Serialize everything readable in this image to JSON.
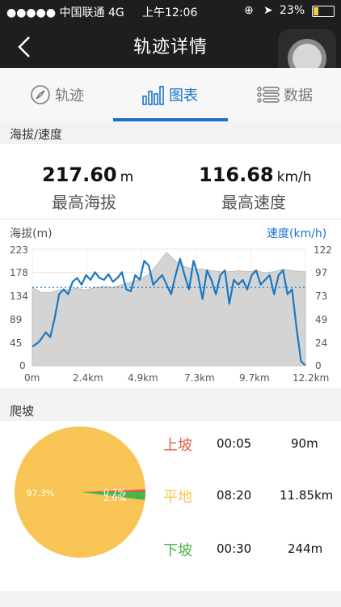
{
  "status_bar": {
    "signal": "●●●●● 中国联通  4G",
    "time": "上午12:06",
    "battery": "23%"
  },
  "nav": {
    "title": "轨迹详情"
  },
  "tabs": [
    {
      "label": "轨迹",
      "icon": "compass-icon"
    },
    {
      "label": "图表",
      "icon": "bar-chart-icon"
    },
    {
      "label": "数据",
      "icon": "list-icon"
    }
  ],
  "summary": {
    "section_title": "海拔/速度",
    "max_altitude": {
      "value": "217.60",
      "unit": "m",
      "label": "最高海拔"
    },
    "max_speed": {
      "value": "116.68",
      "unit": "km/h",
      "label": "最高速度"
    }
  },
  "colors": {
    "accent": "#1a73c7",
    "speed_line": "#1a78c2",
    "altitude_fill": "#d4d4d4",
    "uphill": "#e35d4e",
    "flat": "#f8c456",
    "downhill": "#48b54a"
  },
  "chart_data": [
    {
      "type": "line",
      "left_axis_title": "海拔(m)",
      "right_axis_title": "速度(km/h)",
      "x_ticks": [
        "0m",
        "2.4km",
        "4.9km",
        "7.3km",
        "9.7km",
        "12.2km"
      ],
      "y_left_ticks": [
        "223",
        "178",
        "134",
        "89",
        "45",
        "0"
      ],
      "y_right_ticks": [
        "122",
        "97",
        "73",
        "49",
        "24",
        "0"
      ],
      "x_range_km": [
        0,
        12.2
      ],
      "y_left_range": [
        0,
        223
      ],
      "y_right_range": [
        0,
        122
      ],
      "grid": true,
      "average_speed_reference": 82,
      "series": [
        {
          "name": "海拔",
          "kind": "area",
          "axis": "left",
          "x": [
            0,
            0.4,
            0.8,
            1.2,
            1.6,
            2.0,
            2.4,
            2.8,
            3.2,
            3.6,
            4.0,
            4.4,
            4.8,
            5.2,
            5.6,
            6.0,
            6.4,
            6.8,
            7.2,
            7.6,
            8.0,
            8.4,
            8.8,
            9.2,
            9.6,
            10.0,
            10.4,
            10.8,
            11.2,
            11.6,
            12.2
          ],
          "y": [
            150,
            140,
            140,
            145,
            146,
            148,
            145,
            150,
            152,
            150,
            155,
            160,
            165,
            175,
            195,
            217,
            200,
            190,
            185,
            185,
            182,
            180,
            180,
            182,
            180,
            182,
            178,
            180,
            185,
            182,
            180
          ]
        },
        {
          "name": "速度",
          "kind": "line",
          "axis": "right",
          "x": [
            0,
            0.3,
            0.6,
            0.8,
            1.0,
            1.2,
            1.4,
            1.6,
            1.8,
            2.0,
            2.2,
            2.4,
            2.6,
            2.8,
            3.0,
            3.2,
            3.4,
            3.6,
            3.8,
            4.0,
            4.2,
            4.4,
            4.6,
            4.8,
            5.0,
            5.2,
            5.4,
            5.6,
            5.8,
            6.0,
            6.2,
            6.4,
            6.6,
            6.8,
            7.0,
            7.2,
            7.4,
            7.6,
            7.8,
            8.0,
            8.2,
            8.4,
            8.6,
            8.8,
            9.0,
            9.2,
            9.4,
            9.6,
            9.8,
            10.0,
            10.2,
            10.4,
            10.6,
            10.8,
            11.0,
            11.2,
            11.4,
            11.6,
            11.8,
            12.0,
            12.2
          ],
          "y": [
            20,
            25,
            35,
            30,
            50,
            75,
            80,
            75,
            88,
            92,
            85,
            95,
            90,
            98,
            92,
            90,
            96,
            88,
            92,
            98,
            80,
            78,
            95,
            90,
            110,
            105,
            85,
            90,
            95,
            85,
            75,
            95,
            112,
            95,
            80,
            110,
            95,
            70,
            100,
            90,
            75,
            95,
            100,
            65,
            90,
            85,
            90,
            80,
            95,
            100,
            85,
            90,
            95,
            75,
            95,
            100,
            75,
            80,
            40,
            5,
            0
          ]
        }
      ]
    },
    {
      "type": "pie",
      "title": "爬坡",
      "slices": [
        {
          "name": "平地",
          "value": 97.3,
          "label": "97.3%"
        },
        {
          "name": "上坡",
          "value": 0.7,
          "label": "0.7%"
        },
        {
          "name": "下坡",
          "value": 2.0,
          "label": "2.0%"
        }
      ]
    }
  ],
  "climb": {
    "section_title": "爬坡",
    "rows": [
      {
        "label": "上坡",
        "time": "00:05",
        "distance": "90m"
      },
      {
        "label": "平地",
        "time": "08:20",
        "distance": "11.85km"
      },
      {
        "label": "下坡",
        "time": "00:30",
        "distance": "244m"
      }
    ]
  }
}
